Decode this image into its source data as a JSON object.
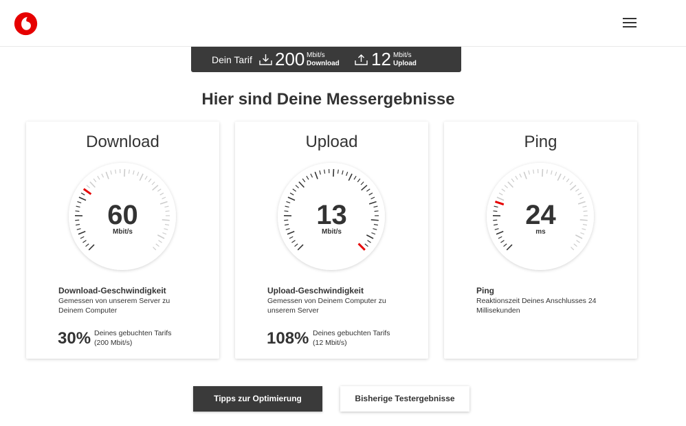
{
  "header": {
    "logo": "vodafone-speechmark-logo",
    "menu_icon": "hamburger-menu-icon",
    "brand_color": "#e60000"
  },
  "tariff": {
    "label": "Dein Tarif",
    "download_value": "200",
    "download_unit": "Mbit/s",
    "download_label": "Download",
    "upload_value": "12",
    "upload_unit": "Mbit/s",
    "upload_label": "Upload",
    "download_icon": "download-icon",
    "upload_icon": "upload-icon",
    "background": "#3a3a3a"
  },
  "page_title": "Hier sind Deine Messergebnisse",
  "cards": [
    {
      "title": "Download",
      "value": "60",
      "unit": "Mbit/s",
      "level": 0.3,
      "heading": "Download-Geschwindigkeit",
      "description": "Gemessen von unserem Server zu Deinem Computer",
      "percent": "30%",
      "percent_desc_line1": "Deines gebuchten Tarifs",
      "percent_desc_line2": "(200 Mbit/s)"
    },
    {
      "title": "Upload",
      "value": "13",
      "unit": "Mbit/s",
      "level": 1.0,
      "heading": "Upload-Geschwindigkeit",
      "description": "Gemessen von Deinem Computer zu unserem Server",
      "percent": "108%",
      "percent_desc_line1": "Deines gebuchten Tarifs",
      "percent_desc_line2": "(12 Mbit/s)"
    },
    {
      "title": "Ping",
      "value": "24",
      "unit": "ms",
      "level": 0.24,
      "heading": "Ping",
      "description": "Reaktionszeit Deines Anschlusses 24 Millisekunden"
    }
  ],
  "buttons": {
    "tips": "Tipps zur Optimierung",
    "history": "Bisherige Testergebnisse"
  },
  "colors": {
    "accent": "#e60000",
    "tick_active": "#333333",
    "tick_inactive": "#cccccc"
  }
}
